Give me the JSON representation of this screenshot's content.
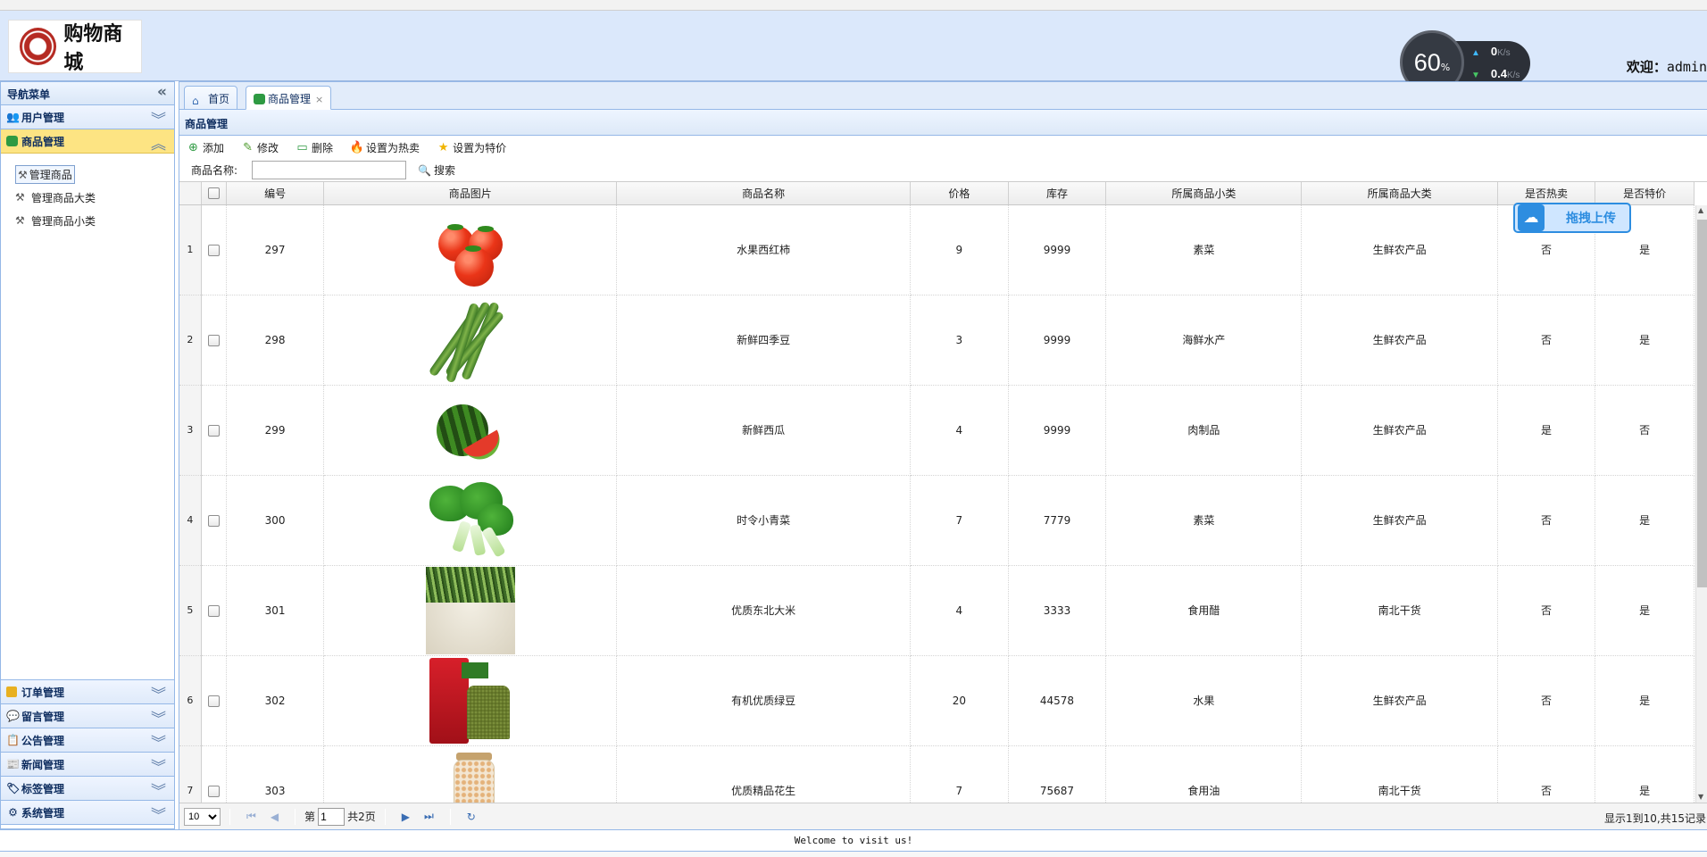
{
  "header": {
    "logo_text": "购物商城",
    "welcome_label": "欢迎：",
    "welcome_user": "admin"
  },
  "speed_widget": {
    "percent": "60",
    "percent_sign": "%",
    "up_value": "0",
    "down_value": "0.4",
    "unit": "K/s"
  },
  "sidebar": {
    "title": "导航菜单",
    "sections": [
      {
        "label": "用户管理",
        "icon": "user-icon"
      },
      {
        "label": "商品管理",
        "icon": "product-icon",
        "active": true
      },
      {
        "label": "订单管理",
        "icon": "order-icon"
      },
      {
        "label": "留言管理",
        "icon": "message-icon"
      },
      {
        "label": "公告管理",
        "icon": "notice-icon"
      },
      {
        "label": "新闻管理",
        "icon": "news-icon"
      },
      {
        "label": "标签管理",
        "icon": "tag-icon"
      },
      {
        "label": "系统管理",
        "icon": "system-icon"
      }
    ],
    "sub_items": [
      {
        "label": "管理商品",
        "selected": true
      },
      {
        "label": "管理商品大类"
      },
      {
        "label": "管理商品小类"
      }
    ]
  },
  "tabs": [
    {
      "label": "首页"
    },
    {
      "label": "商品管理",
      "active": true,
      "close": "×"
    }
  ],
  "panel": {
    "title": "商品管理"
  },
  "toolbar": {
    "add": "添加",
    "edit": "修改",
    "delete": "删除",
    "set_hot": "设置为热卖",
    "set_special": "设置为特价"
  },
  "search": {
    "label": "商品名称:",
    "value": "",
    "button": "搜索"
  },
  "upload_badge": {
    "label": "拖拽上传"
  },
  "table": {
    "columns": [
      "编号",
      "商品图片",
      "商品名称",
      "价格",
      "库存",
      "所属商品小类",
      "所属商品大类",
      "是否热卖",
      "是否特价"
    ],
    "rows": [
      {
        "n": "1",
        "id": "297",
        "image": "tomato",
        "name": "水果西红柿",
        "price": "9",
        "stock": "9999",
        "sub": "素菜",
        "cat": "生鲜农产品",
        "hot": "否",
        "special": "是"
      },
      {
        "n": "2",
        "id": "298",
        "image": "green-beans",
        "name": "新鲜四季豆",
        "price": "3",
        "stock": "9999",
        "sub": "海鲜水产",
        "cat": "生鲜农产品",
        "hot": "否",
        "special": "是"
      },
      {
        "n": "3",
        "id": "299",
        "image": "watermelon",
        "name": "新鲜西瓜",
        "price": "4",
        "stock": "9999",
        "sub": "肉制品",
        "cat": "生鲜农产品",
        "hot": "是",
        "special": "否"
      },
      {
        "n": "4",
        "id": "300",
        "image": "bok-choy",
        "name": "时令小青菜",
        "price": "7",
        "stock": "7779",
        "sub": "素菜",
        "cat": "生鲜农产品",
        "hot": "否",
        "special": "是"
      },
      {
        "n": "5",
        "id": "301",
        "image": "rice",
        "name": "优质东北大米",
        "price": "4",
        "stock": "3333",
        "sub": "食用醋",
        "cat": "南北干货",
        "hot": "否",
        "special": "是"
      },
      {
        "n": "6",
        "id": "302",
        "image": "mung-beans",
        "name": "有机优质绿豆",
        "price": "20",
        "stock": "44578",
        "sub": "水果",
        "cat": "生鲜农产品",
        "hot": "否",
        "special": "是"
      },
      {
        "n": "7",
        "id": "303",
        "image": "peanuts",
        "name": "优质精品花生",
        "price": "7",
        "stock": "75687",
        "sub": "食用油",
        "cat": "南北干货",
        "hot": "否",
        "special": "是"
      }
    ]
  },
  "pager": {
    "page_size": "10",
    "page_label_before": "第",
    "page_value": "1",
    "page_label_after": "共2页",
    "info": "显示1到10,共15记录"
  },
  "footer": {
    "text": "Welcome to visit us!"
  }
}
